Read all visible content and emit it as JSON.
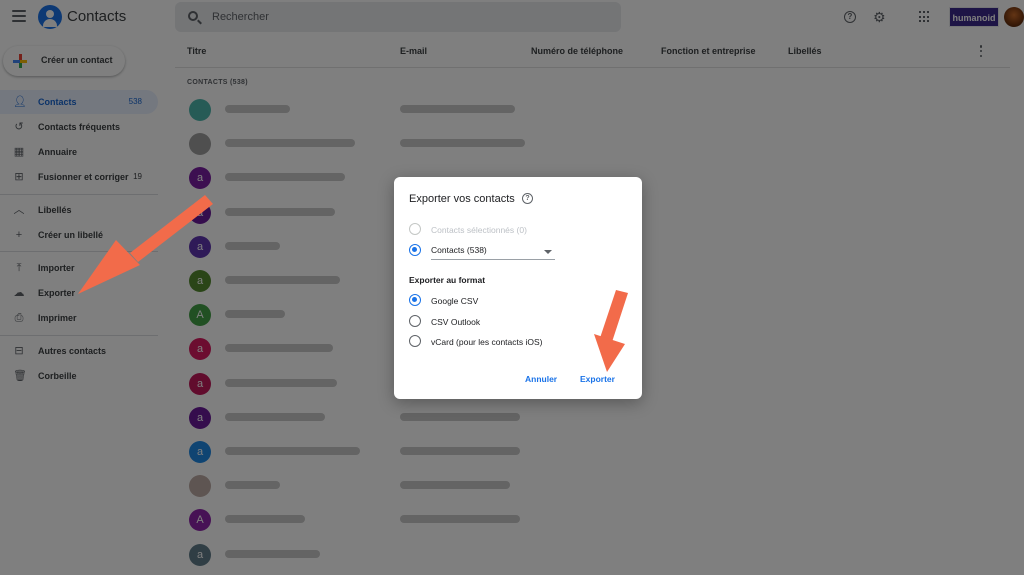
{
  "header": {
    "app_title": "Contacts",
    "search_placeholder": "Rechercher",
    "brand_label": "humanoid"
  },
  "sidebar": {
    "create_label": "Créer un contact",
    "items": [
      {
        "label": "Contacts",
        "count": "538",
        "icon": "person-icon"
      },
      {
        "label": "Contacts fréquents",
        "count": "",
        "icon": "history-icon"
      },
      {
        "label": "Annuaire",
        "count": "",
        "icon": "directory-icon"
      },
      {
        "label": "Fusionner et corriger",
        "count": "19",
        "icon": "merge-icon"
      },
      {
        "label": "Libellés",
        "count": "",
        "icon": "chevron-up-icon"
      },
      {
        "label": "Créer un libellé",
        "count": "",
        "icon": "plus-icon"
      },
      {
        "label": "Importer",
        "count": "",
        "icon": "upload-icon"
      },
      {
        "label": "Exporter",
        "count": "",
        "icon": "cloud-download-icon"
      },
      {
        "label": "Imprimer",
        "count": "",
        "icon": "printer-icon"
      },
      {
        "label": "Autres contacts",
        "count": "",
        "icon": "archive-icon"
      },
      {
        "label": "Corbeille",
        "count": "",
        "icon": "trash-icon"
      }
    ]
  },
  "list": {
    "columns": [
      "Titre",
      "E-mail",
      "Numéro de téléphone",
      "Fonction et entreprise",
      "Libellés"
    ],
    "section_label": "CONTACTS (538)",
    "rows": [
      {
        "initial": "",
        "color": "#4db6ac"
      },
      {
        "initial": "",
        "color": "#9e9e9e"
      },
      {
        "initial": "a",
        "color": "#7b1fa2"
      },
      {
        "initial": "a",
        "color": "#6a1b9a"
      },
      {
        "initial": "a",
        "color": "#5e35b1"
      },
      {
        "initial": "a",
        "color": "#558b2f"
      },
      {
        "initial": "A",
        "color": "#43a047"
      },
      {
        "initial": "a",
        "color": "#d81b60"
      },
      {
        "initial": "a",
        "color": "#c2185b"
      },
      {
        "initial": "a",
        "color": "#6a1b9a"
      },
      {
        "initial": "a",
        "color": "#1e88e5"
      },
      {
        "initial": "",
        "color": "#bcaaa4"
      },
      {
        "initial": "A",
        "color": "#8e24aa"
      },
      {
        "initial": "a",
        "color": "#607d8b"
      }
    ]
  },
  "dialog": {
    "title": "Exporter vos contacts",
    "option_selected": "Contacts sélectionnés (0)",
    "option_contacts": "Contacts (538)",
    "format_heading": "Exporter au format",
    "formats": [
      "Google CSV",
      "CSV Outlook",
      "vCard (pour les contacts iOS)"
    ],
    "cancel_label": "Annuler",
    "export_label": "Exporter"
  },
  "colors": {
    "accent": "#1a73e8",
    "annotation_arrow": "#f26b4a",
    "brand_bg": "#3d2a8c"
  }
}
